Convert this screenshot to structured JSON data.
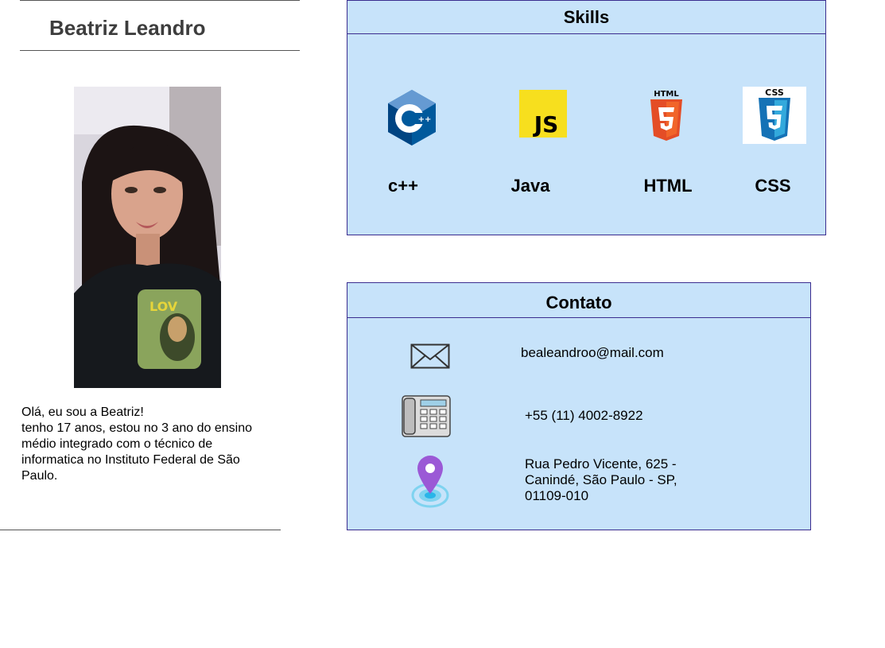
{
  "profile": {
    "name": "Beatriz Leandro",
    "bio_line1": "Olá, eu sou a Beatriz!",
    "bio_line2": "tenho 17 anos, estou no 3 ano do ensino médio integrado com o técnico de informatica no Instituto Federal de São Paulo."
  },
  "skills": {
    "title": "Skills",
    "items": [
      {
        "label": "c++",
        "icon": "cpp-logo-icon"
      },
      {
        "label": "Java",
        "icon": "js-logo-icon",
        "logo_text": "JS"
      },
      {
        "label": "HTML",
        "icon": "html5-logo-icon",
        "logo_text": "HTML"
      },
      {
        "label": "CSS",
        "icon": "css3-logo-icon",
        "logo_text": "CSS"
      }
    ]
  },
  "contact": {
    "title": "Contato",
    "email": "bealeandroo@mail.com",
    "phone": "+55 (11) 4002-8922",
    "address_line1": "Rua Pedro Vicente, 625 -",
    "address_line2": "Canindé, São Paulo - SP,",
    "address_line3": "01109-010"
  },
  "colors": {
    "panel_bg": "#c7e3fa",
    "panel_border": "#3b2d8f",
    "name_text": "#3d3d3d"
  }
}
